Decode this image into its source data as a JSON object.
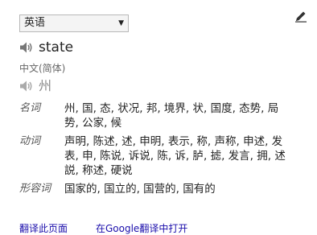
{
  "language_select": {
    "selected": "英语"
  },
  "source": {
    "word": "state"
  },
  "target": {
    "language": "中文(简体)",
    "transliteration": "州"
  },
  "dictionary": [
    {
      "pos": "名词",
      "words": "州, 国, 态, 状况, 邦, 境界, 状, 国度, 态势, 局势, 公家, 候"
    },
    {
      "pos": "动词",
      "words": "声明, 陈述, 述, 申明, 表示, 称, 声称, 申述, 发表, 申, 陈说, 诉说, 陈, 诉, 胪, 摅, 发言, 拥, 述説, 称述, 硬说"
    },
    {
      "pos": "形容词",
      "words": "国家的, 国立的, 国营的, 国有的"
    }
  ],
  "footer": {
    "translate_page_link": "翻译此页面",
    "open_in_google_translate_link": "在Google翻译中打开"
  },
  "icons": {
    "edit": "pencil-icon",
    "source_audio": "speaker-icon",
    "target_audio": "speaker-icon"
  },
  "colors": {
    "link": "#1a0dab",
    "muted_text": "#666666"
  }
}
